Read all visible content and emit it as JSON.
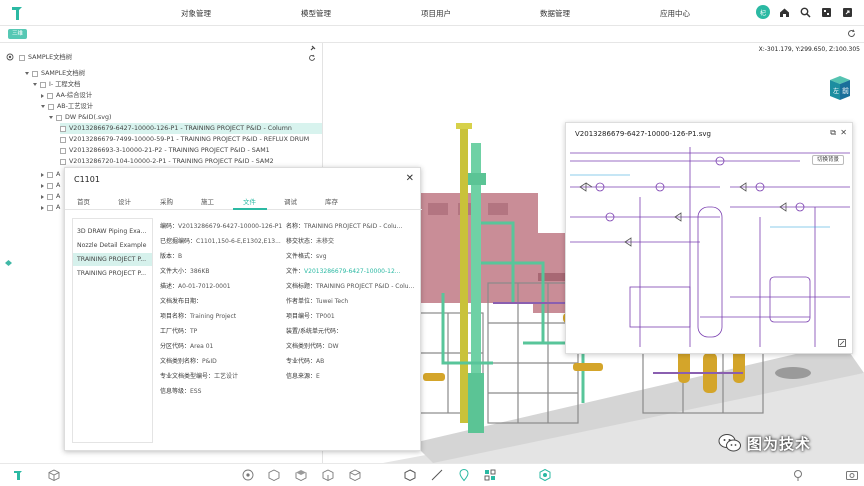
{
  "nav": {
    "items": [
      "对象管理",
      "模型管理",
      "项目用户",
      "数据管理",
      "应用中心"
    ],
    "avatar_text": "杞",
    "colors": {
      "accent": "#2bb9a3"
    }
  },
  "subbar": {
    "chip": "三维"
  },
  "tree": {
    "root": "SAMPLE文档树",
    "rows": [
      "SAMPLE文档树",
      "I- 工程文档",
      "AA-综合设计",
      "AB-工艺设计",
      "DW P&ID(.svg)",
      "V2013286679-6427-10000-126-P1 - TRAINING PROJECT P&ID - Column",
      "V2013286679-7499-10000-59-P1 - TRAINING PROJECT P&ID - REFLUX DRUM",
      "V2013286693-3-10000-21-P2 - TRAINING PROJECT P&ID - SAM1",
      "V2013286720-104-10000-2-P1 - TRAINING PROJECT P&ID - SAM2",
      "A",
      "A",
      "A",
      "A"
    ]
  },
  "viewport": {
    "coords": "X:-301.179, Y:299.650, Z:100.305",
    "cube_label": "前",
    "cube_side": "左"
  },
  "doc": {
    "title": "C1101",
    "tabs": [
      "首页",
      "设计",
      "采购",
      "施工",
      "文件",
      "调试",
      "库存"
    ],
    "active_tab": "文件",
    "list": [
      "3D DRAW Piping Exa...",
      "Nozzle Detail Example",
      "TRAINING PROJECT P...",
      "TRAINING PROJECT P..."
    ],
    "left_fields": [
      {
        "k": "编码：",
        "v": "V2013286679-6427-10000-126-P1"
      },
      {
        "k": "已挖掘编码：",
        "v": "C1101,150-6-E,E1302,E13..."
      },
      {
        "k": "版本：",
        "v": "B"
      },
      {
        "k": "文件大小：",
        "v": "386KB"
      },
      {
        "k": "描述：",
        "v": "A0-01-7012-0001"
      },
      {
        "k": "文档发布日期：",
        "v": ""
      },
      {
        "k": "项目名称：",
        "v": "Training Project"
      },
      {
        "k": "工厂代码：",
        "v": "TP"
      },
      {
        "k": "分区代码：",
        "v": "Area 01"
      },
      {
        "k": "文档类别名称：",
        "v": "P&ID"
      },
      {
        "k": "专业文档类型编号：",
        "v": "工艺设计"
      },
      {
        "k": "信息等级：",
        "v": "ESS"
      }
    ],
    "right_fields": [
      {
        "k": "名称：",
        "v": "TRAINING PROJECT P&ID - Colu..."
      },
      {
        "k": "移交状态：",
        "v": "未移交"
      },
      {
        "k": "文件格式：",
        "v": "svg"
      },
      {
        "k": "文件：",
        "v": "V2013286679-6427-10000-12..."
      },
      {
        "k": "文档标题：",
        "v": "TRAINING PROJECT P&ID - Colu..."
      },
      {
        "k": "作者单位：",
        "v": "Tuwei Tech"
      },
      {
        "k": "项目编号：",
        "v": "TP001"
      },
      {
        "k": "装置/系统单元代码：",
        "v": ""
      },
      {
        "k": "文档类别代码：",
        "v": "DW"
      },
      {
        "k": "专业代码：",
        "v": "AB"
      },
      {
        "k": "信息来源：",
        "v": "E"
      }
    ]
  },
  "svgview": {
    "title": "V2013286679-6427-10000-126-P1.svg",
    "switch_label": "切换背景"
  },
  "watermark": {
    "text": "图为技术"
  }
}
